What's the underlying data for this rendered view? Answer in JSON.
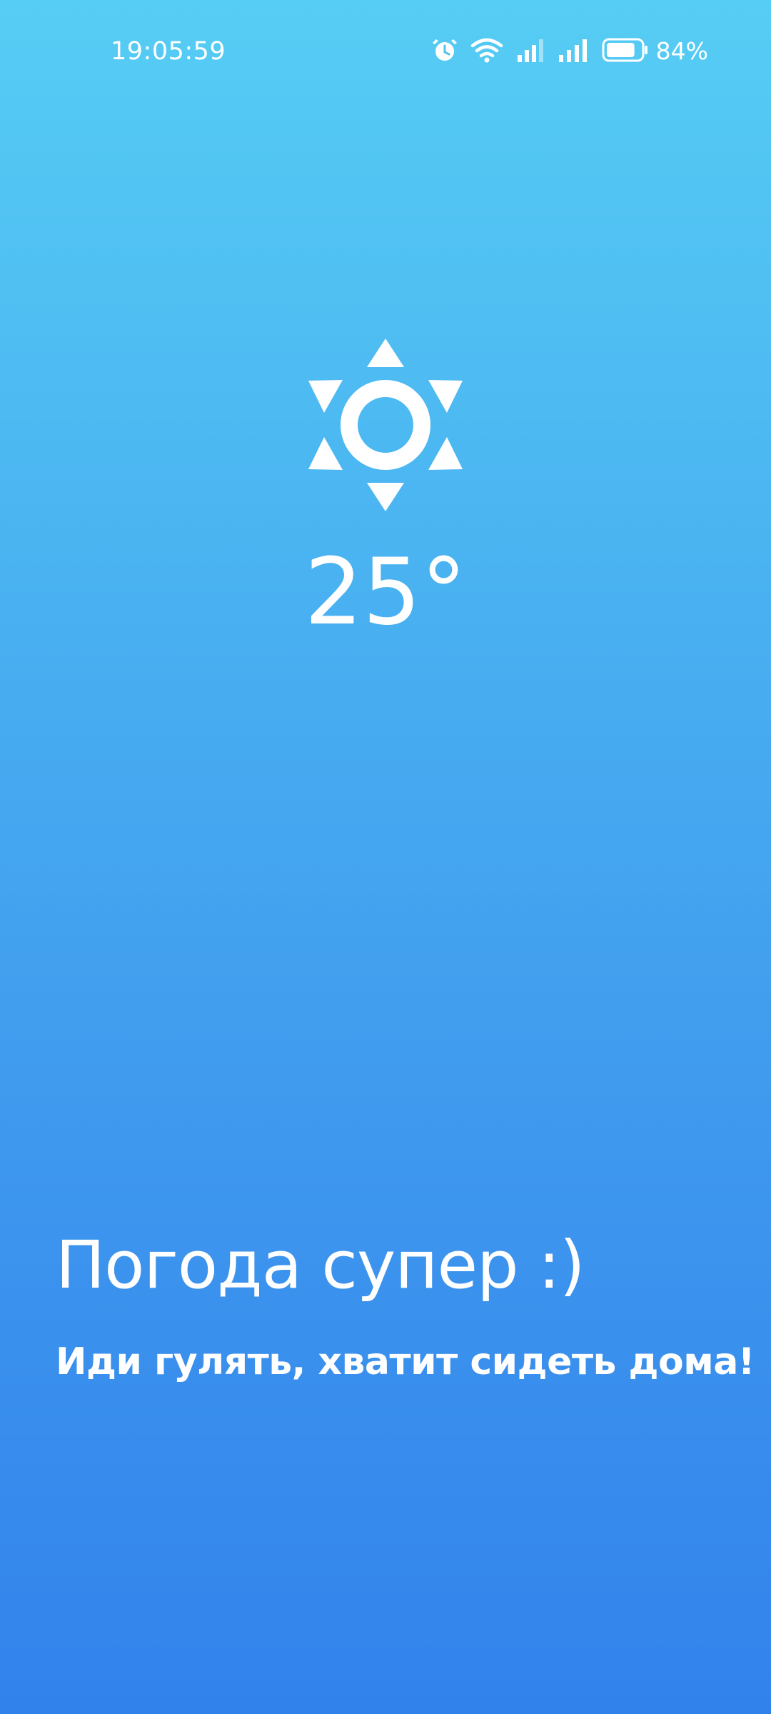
{
  "status_bar": {
    "time": "19:05:59",
    "battery_percent": "84%",
    "battery_level": 0.84,
    "icons": [
      "alarm-icon",
      "wifi-icon",
      "signal-icon",
      "signal-icon",
      "battery-icon"
    ]
  },
  "weather": {
    "icon": "sun-icon",
    "temperature": "25°",
    "headline": "Погода супер :)",
    "message": "Иди гулять, хватит сидеть дома!"
  },
  "colors": {
    "background_top": "#56cdf4",
    "background_bottom": "#3282ec",
    "foreground": "#ffffff"
  }
}
